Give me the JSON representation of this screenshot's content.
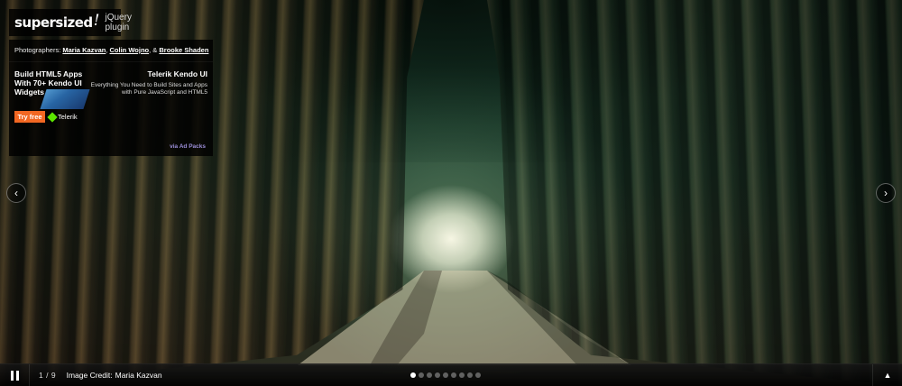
{
  "logo": {
    "name": "supersized",
    "mark": "!",
    "tagline": "jQuery plugin"
  },
  "credits": {
    "prefix": "Photographers:",
    "photographers": [
      "Maria Kazvan",
      "Colin Wojno",
      "Brooke Shaden"
    ],
    "separator_1": ",",
    "separator_2": ", &"
  },
  "ad": {
    "headline": "Build HTML5 Apps With 70+ Kendo UI Widgets",
    "cta_label": "Try free",
    "brand": "Telerik",
    "title": "Telerik Kendo UI",
    "description": "Everything You Need to Build Sites and Apps with Pure JavaScript and HTML5",
    "via": "via Ad Packs",
    "colors": {
      "cta": "#f26722",
      "via": "#9b8ed8",
      "brand_mark": "#5ce500"
    }
  },
  "nav": {
    "prev_icon": "chevron-left-icon",
    "prev_glyph": "‹",
    "next_icon": "chevron-right-icon",
    "next_glyph": "›"
  },
  "controls": {
    "pause_icon": "pause-icon",
    "current_slide": "1",
    "counter_sep": "/",
    "total_slides": "9",
    "credit_label": "Image Credit:",
    "credit_name": "Maria Kazvan",
    "dot_count": 9,
    "active_dot": 1,
    "tray_icon": "triangle-up-icon",
    "tray_glyph": "▲"
  }
}
